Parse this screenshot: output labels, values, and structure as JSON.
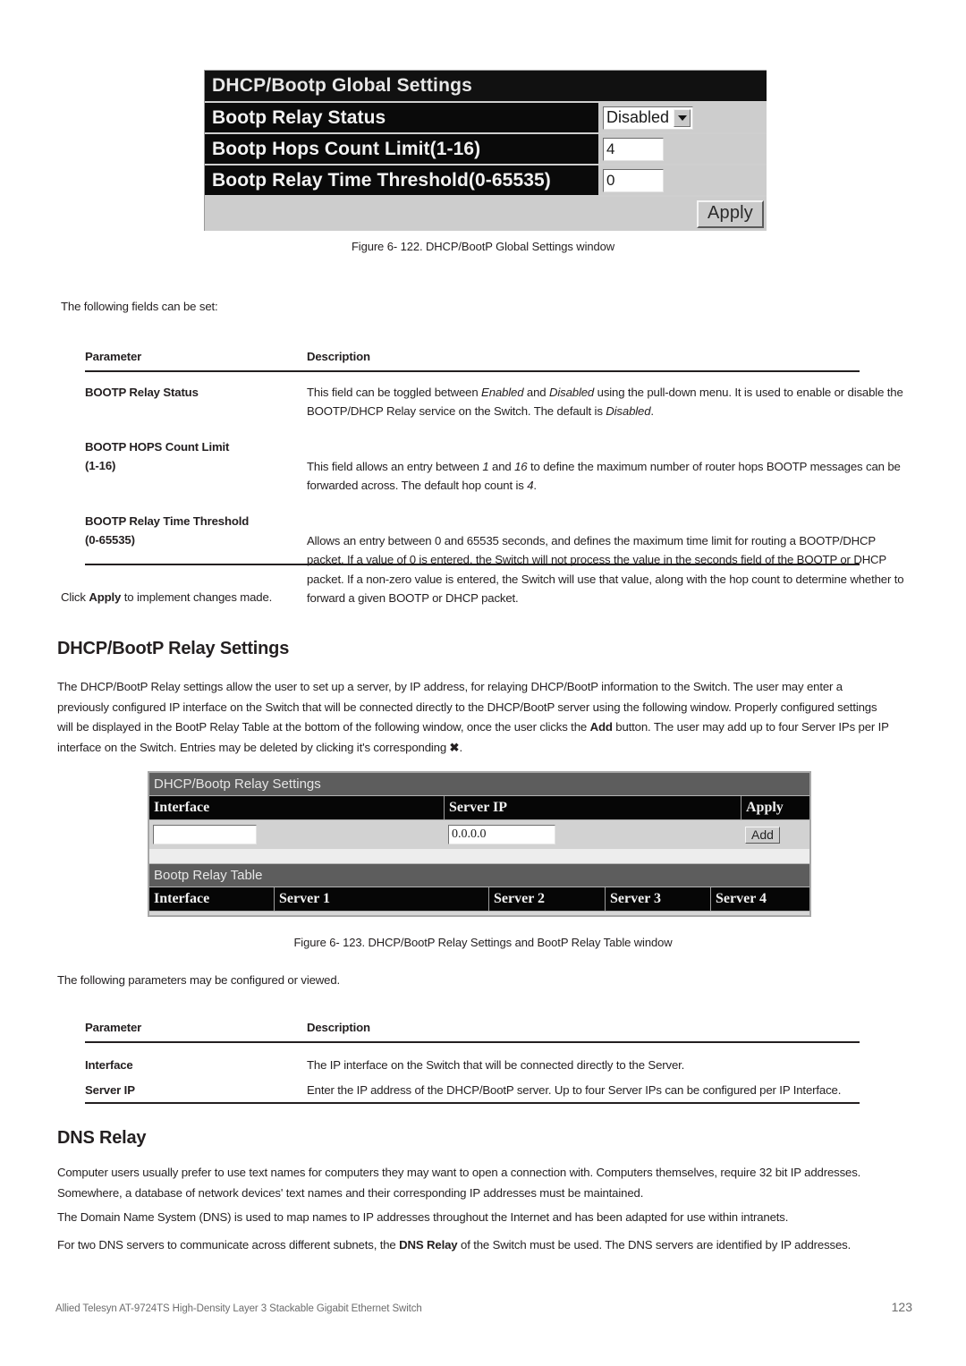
{
  "document": {
    "page_number": "123",
    "footer_text": "Allied Telesyn AT-9724TS High-Density Layer 3 Stackable Gigabit Ethernet Switch"
  },
  "figure_122": {
    "caption": "Figure 6- 122. DHCP/BootP Global Settings window",
    "window": {
      "title": "DHCP/Bootp Global Settings",
      "rows": [
        {
          "label": "Bootp Relay Status",
          "control": "select",
          "value": "Disabled"
        },
        {
          "label": "Bootp Hops Count Limit(1-16)",
          "control": "text",
          "value": "4"
        },
        {
          "label": "Bootp Relay Time Threshold(0-65535)",
          "control": "text",
          "value": "0"
        }
      ],
      "apply_label": "Apply"
    }
  },
  "intro_1": "The following fields can be set:",
  "table_1": {
    "header": {
      "parameter": "Parameter",
      "description": "Description"
    },
    "rows": [
      {
        "parameter": "BOOTP Relay Status",
        "parameter_line2": "",
        "description_html": "This field can be toggled between <i>Enabled</i> and <i>Disabled</i> using the pull-down menu. It is used to enable or disable the BOOTP/DHCP Relay service on the Switch. The default is <i>Disabled</i>."
      },
      {
        "parameter": "BOOTP HOPS Count Limit",
        "parameter_line2": "(1-16)",
        "description_html": "This field allows an entry between <i>1</i> and <i>16</i> to define the maximum number of router hops BOOTP messages can be forwarded across. The default hop count is <i>4</i>."
      },
      {
        "parameter": "BOOTP Relay Time Threshold",
        "parameter_line2": "(0-65535)",
        "description_html": "Allows an entry between 0 and 65535 seconds, and defines the maximum time limit for routing a BOOTP/DHCP packet. If a value of 0 is entered, the Switch will not process the value in the seconds field of the BOOTP or DHCP packet. If a non-zero value is entered, the Switch will use that value, along with the hop count to determine whether to forward a given BOOTP or DHCP packet."
      }
    ]
  },
  "apply_note_html": "Click <b>Apply</b> to implement changes made.",
  "section_relay": {
    "heading": "DHCP/BootP Relay Settings",
    "paragraph_html": "The DHCP/BootP Relay settings allow the user to set up a server, by IP address, for relaying DHCP/BootP information to the Switch. The user may enter a previously configured IP interface on the Switch that will be connected directly to the DHCP/BootP server using the following window. Properly configured settings will be displayed in the BootP Relay Table at the bottom of the following window, once the user clicks the <b>Add</b> button. The user may add up to four Server IPs per IP interface on the Switch. Entries may be deleted by clicking it's corresponding <b>&#10006;</b>."
  },
  "figure_123": {
    "caption": "Figure 6- 123. DHCP/BootP Relay Settings and BootP Relay Table window",
    "window": {
      "title": "DHCP/Bootp Relay Settings",
      "headers": {
        "interface": "Interface",
        "server_ip": "Server IP",
        "apply": "Apply"
      },
      "inputs": {
        "interface_value": "",
        "server_ip_value": "0.0.0.0",
        "add_label": "Add"
      },
      "table_title": "Bootp Relay Table",
      "table_headers": [
        "Interface",
        "Server 1",
        "Server 2",
        "Server 3",
        "Server 4"
      ],
      "table_rows": []
    }
  },
  "intro_2": "The following parameters may be configured or viewed.",
  "table_2": {
    "header": {
      "parameter": "Parameter",
      "description": "Description"
    },
    "rows": [
      {
        "parameter": "Interface",
        "description_html": "The IP interface on the Switch that will be connected directly to the Server."
      },
      {
        "parameter": "Server IP",
        "description_html": "Enter the IP address of the DHCP/BootP server. Up to four Server IPs can be configured per IP Interface."
      }
    ]
  },
  "section_dns": {
    "heading": "DNS Relay",
    "paragraph_1": "Computer users usually prefer to use text names for computers they may want to open a connection with. Computers themselves, require 32 bit IP addresses. Somewhere, a database of network devices' text names and their corresponding IP addresses must be maintained.",
    "paragraph_2": "The Domain Name System (DNS) is used to map names to IP addresses throughout the Internet and has been adapted for use within intranets.",
    "paragraph_3_html": "For two DNS servers to communicate across different subnets, the <b>DNS Relay</b> of the Switch must be used. The DNS servers are identified by IP addresses."
  }
}
